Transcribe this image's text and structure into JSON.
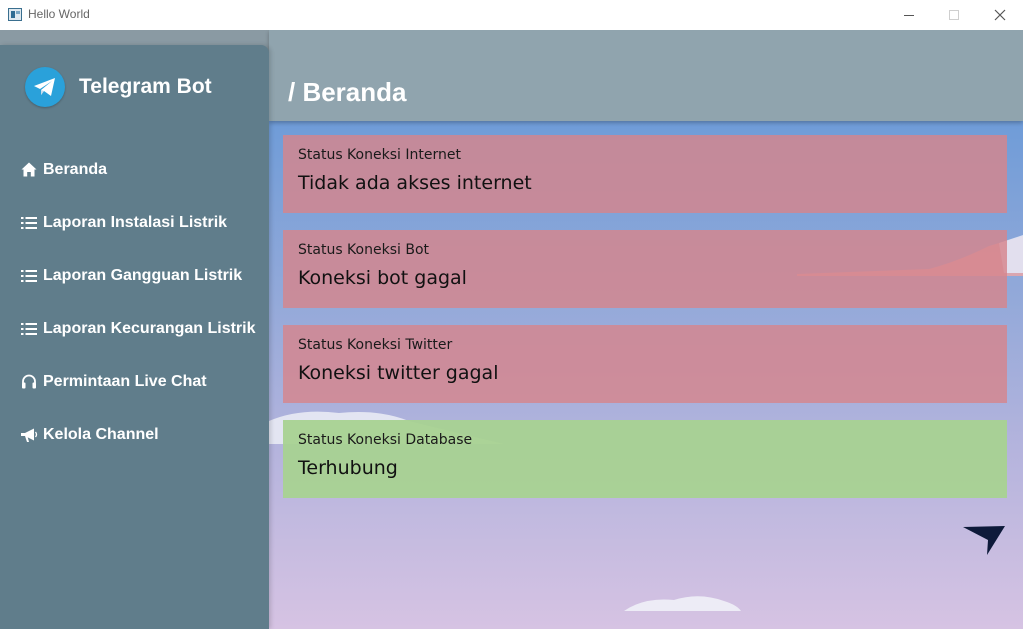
{
  "window": {
    "title": "Hello World"
  },
  "sidebar": {
    "brand": "Telegram Bot",
    "items": [
      {
        "label": "Beranda",
        "icon": "home-icon"
      },
      {
        "label": "Laporan Instalasi Listrik",
        "icon": "list-icon"
      },
      {
        "label": "Laporan Gangguan Listrik",
        "icon": "list-icon"
      },
      {
        "label": "Laporan Kecurangan Listrik",
        "icon": "list-icon"
      },
      {
        "label": "Permintaan Live Chat",
        "icon": "headset-icon"
      },
      {
        "label": "Kelola Channel",
        "icon": "megaphone-icon"
      }
    ]
  },
  "header": {
    "title": "/ Beranda"
  },
  "status_cards": [
    {
      "label": "Status Koneksi Internet",
      "value": "Tidak ada akses internet",
      "state": "error"
    },
    {
      "label": "Status Koneksi Bot",
      "value": "Koneksi bot gagal",
      "state": "error"
    },
    {
      "label": "Status Koneksi Twitter",
      "value": "Koneksi twitter gagal",
      "state": "error"
    },
    {
      "label": "Status Koneksi Database",
      "value": "Terhubung",
      "state": "ok"
    }
  ],
  "colors": {
    "sidebar": "#607d8b",
    "header": "#90a4ae",
    "error_card": "#d6858c",
    "ok_card": "#a8d291",
    "telegram_blue": "#2aa1da"
  }
}
